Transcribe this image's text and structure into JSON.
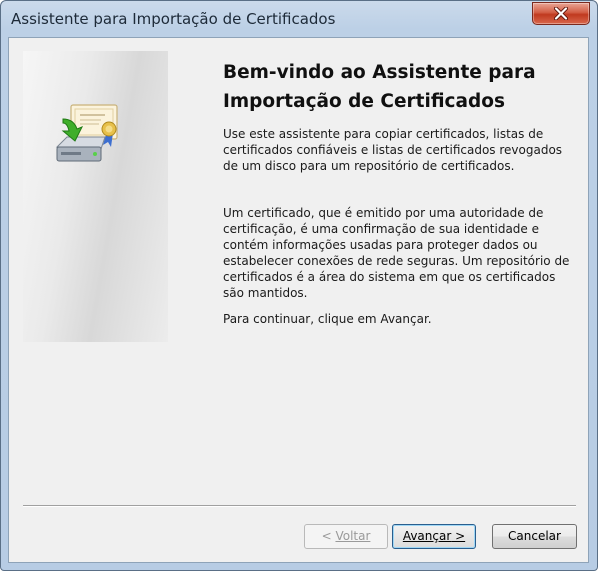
{
  "window": {
    "title": "Assistente para Importação de Certificados",
    "close_icon": "close-icon"
  },
  "banner": {
    "icon": "certificate-import-icon"
  },
  "content": {
    "heading_line1": "Bem-vindo ao Assistente para",
    "heading_line2": "Importação de Certificados",
    "paragraph1": "Use este assistente para copiar certificados, listas de certificados confiáveis e listas de certificados revogados de um disco para um repositório de certificados.",
    "paragraph2": "Um certificado, que é emitido por uma autoridade de certificação, é uma confirmação de sua identidade e contém informações usadas para proteger dados ou estabelecer conexões de rede seguras. Um repositório de certificados é a área do sistema em que os certificados são mantidos.",
    "paragraph3": "Para continuar, clique em Avançar."
  },
  "buttons": {
    "back_prefix": "< ",
    "back_label": "Voltar",
    "next_label": "Avançar",
    "next_suffix": " >",
    "cancel_label": "Cancelar"
  },
  "colors": {
    "close_button": "#c7432b",
    "default_button_border": "#2a5e8e"
  }
}
